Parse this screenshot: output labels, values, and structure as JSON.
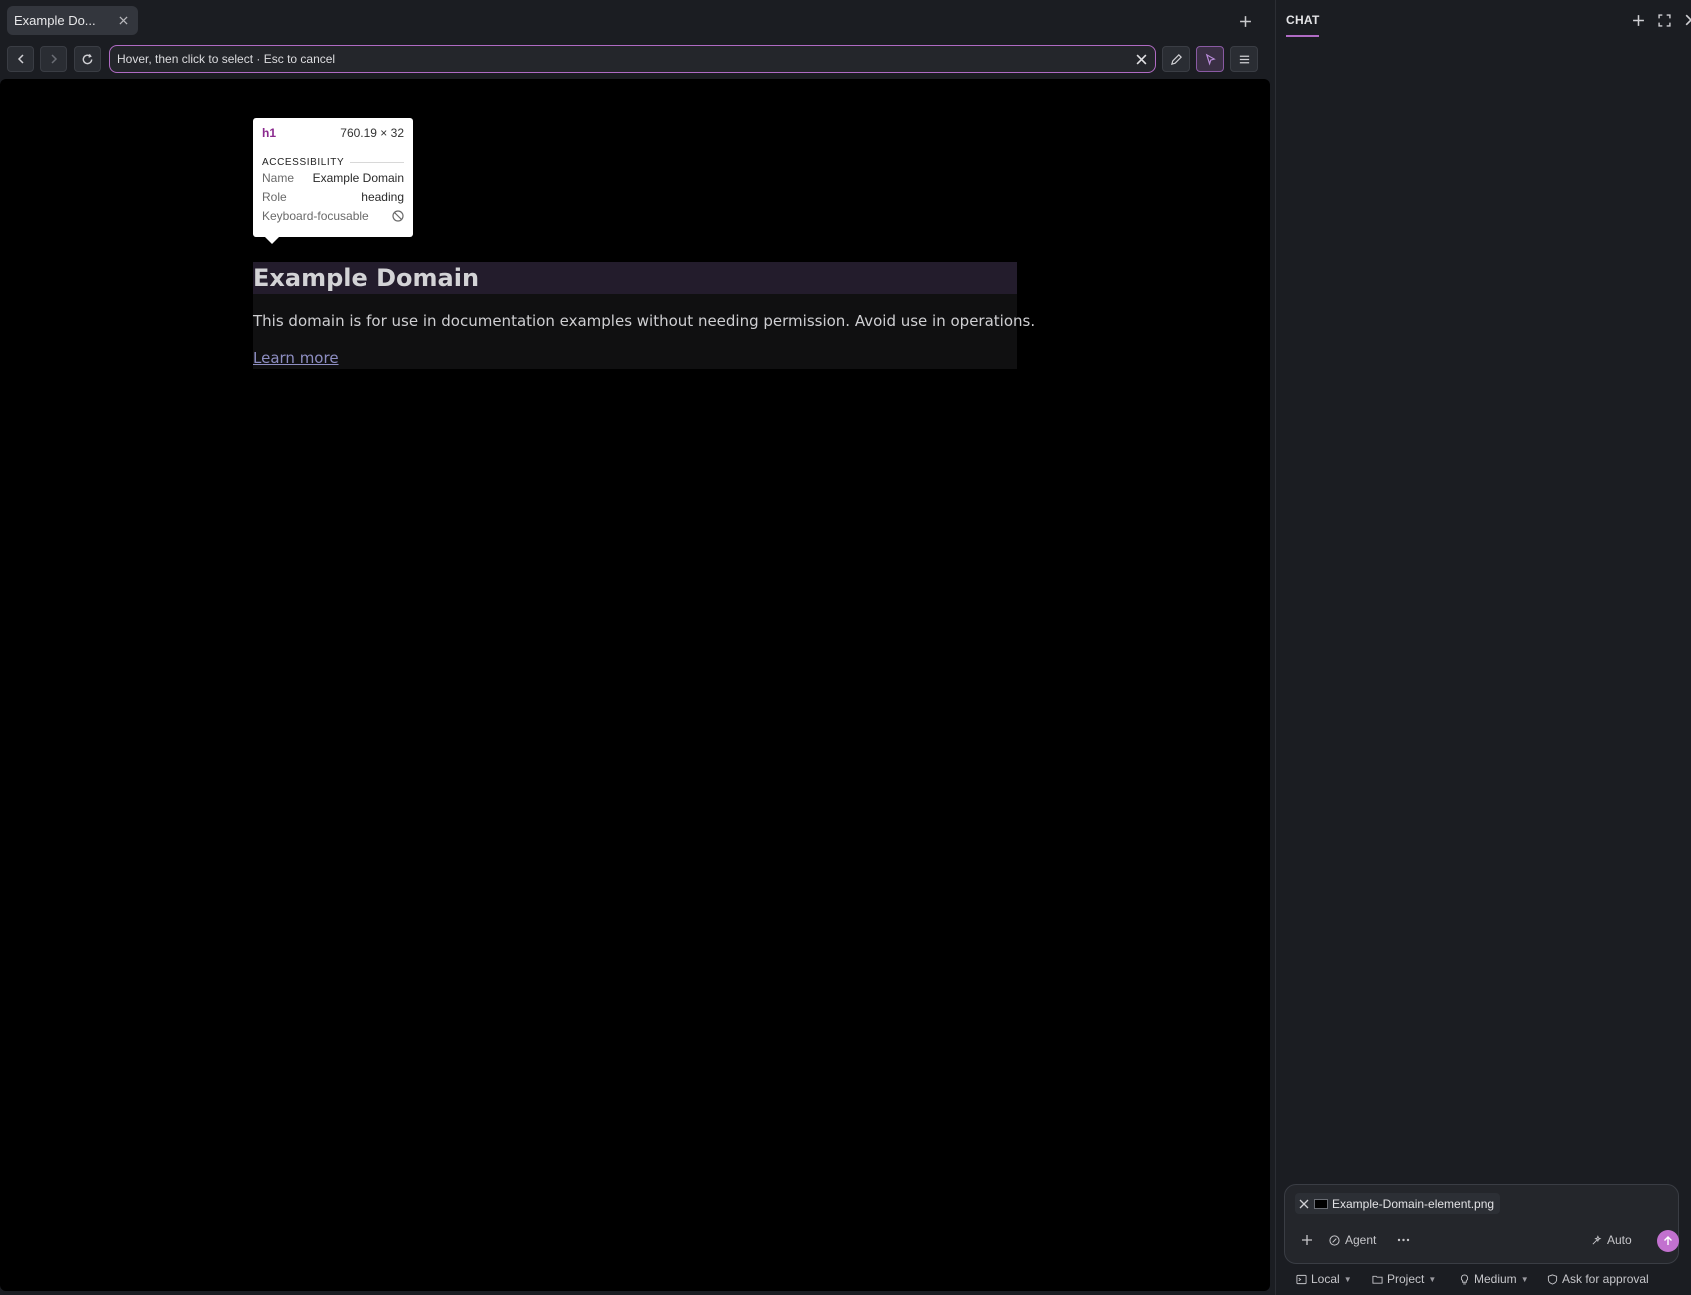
{
  "browser": {
    "tab": {
      "title": "Example Do..."
    },
    "url_bar": {
      "text": "Hover, then click to select · Esc to cancel"
    }
  },
  "page": {
    "heading": "Example Domain",
    "paragraph": "This domain is for use in documentation examples without needing permission. Avoid use in operations.",
    "link": "Learn more"
  },
  "inspector": {
    "tag": "h1",
    "size": "760.19 × 32",
    "section_title": "ACCESSIBILITY",
    "rows": [
      {
        "key": "Name",
        "value": "Example Domain"
      },
      {
        "key": "Role",
        "value": "heading"
      },
      {
        "key": "Keyboard-focusable",
        "value": ""
      }
    ]
  },
  "chat": {
    "title": "CHAT",
    "attachment": {
      "name": "Example-Domain-element.png"
    },
    "composer": {
      "mode_label": "Agent",
      "auto_label": "Auto"
    },
    "status": {
      "environment": "Local",
      "scope": "Project",
      "effort": "Medium",
      "approval": "Ask for approval"
    }
  },
  "colors": {
    "accent": "#b06bc4",
    "send_button": "#c271cf",
    "inspector_tag": "#8b2a8e",
    "link": "#8e8ec2"
  },
  "icons": [
    "close-icon",
    "plus-icon",
    "arrow-left-icon",
    "arrow-right-icon",
    "reload-icon",
    "pencil-icon",
    "cursor-icon",
    "menu-icon",
    "maximize-icon",
    "not-allowed-icon",
    "agent-icon",
    "more-icon",
    "arrow-up-icon",
    "terminal-icon",
    "folder-icon",
    "lightbulb-icon",
    "shield-icon",
    "chevron-down-icon"
  ]
}
